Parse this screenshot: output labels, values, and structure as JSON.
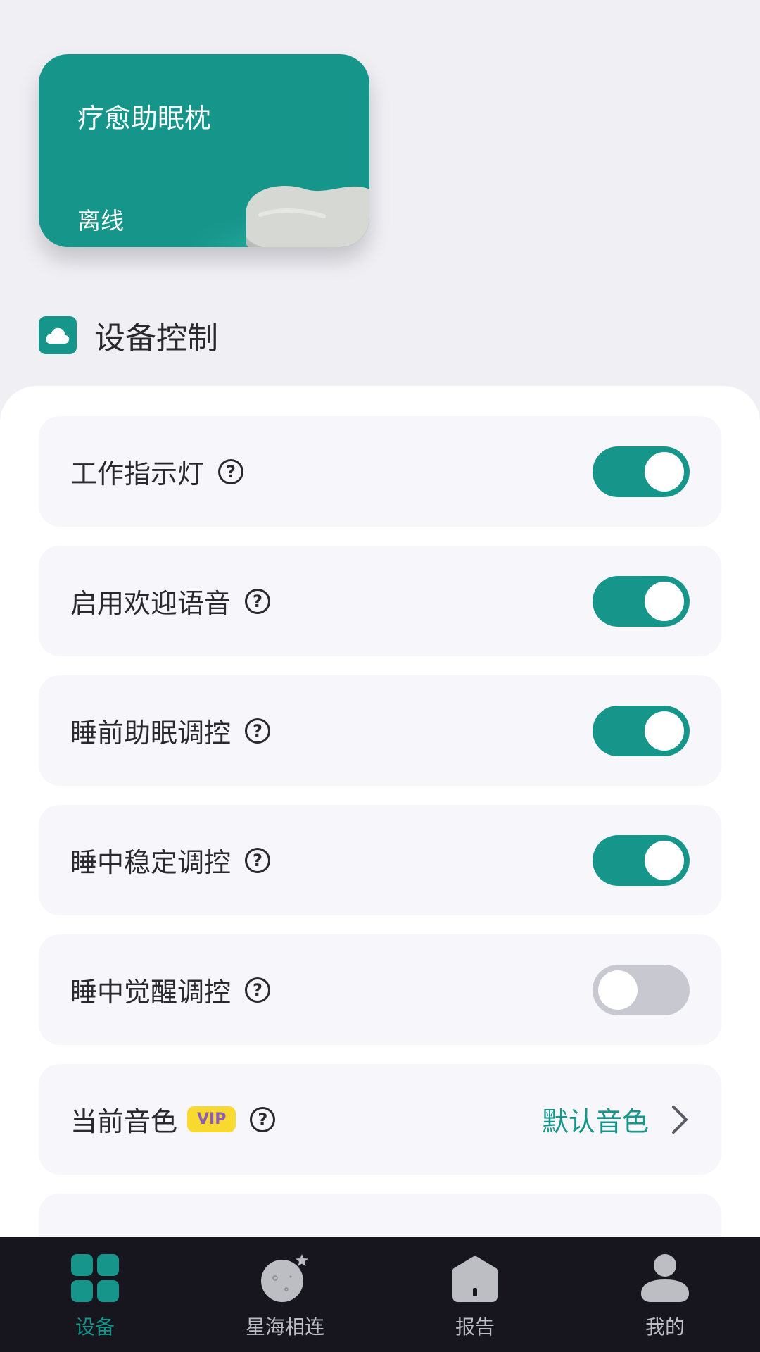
{
  "device": {
    "name": "疗愈助眠枕",
    "status": "离线"
  },
  "section": {
    "title": "设备控制"
  },
  "controls": [
    {
      "label": "工作指示灯",
      "toggle_on": true
    },
    {
      "label": "启用欢迎语音",
      "toggle_on": true
    },
    {
      "label": "睡前助眠调控",
      "toggle_on": true
    },
    {
      "label": "睡中稳定调控",
      "toggle_on": true
    },
    {
      "label": "睡中觉醒调控",
      "toggle_on": false
    }
  ],
  "help_glyph": "?",
  "voice": {
    "label": "当前音色",
    "badge": "VIP",
    "value": "默认音色"
  },
  "nav": {
    "items": [
      {
        "label": "设备",
        "icon": "grid-icon",
        "active": true
      },
      {
        "label": "星海相连",
        "icon": "planet-icon",
        "active": false
      },
      {
        "label": "报告",
        "icon": "report-house-icon",
        "active": false
      },
      {
        "label": "我的",
        "icon": "user-icon",
        "active": false
      }
    ]
  },
  "colors": {
    "accent": "#16968A",
    "toggle_off": "#C7C8D0",
    "vip_bg": "#F7D930",
    "vip_text": "#8B5CB8",
    "nav_bg": "#17161F"
  }
}
